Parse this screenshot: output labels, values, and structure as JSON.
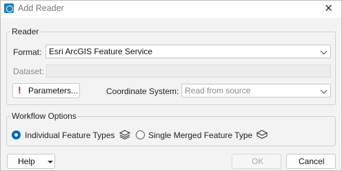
{
  "window": {
    "title": "Add Reader",
    "close_glyph": "✕"
  },
  "reader_group": {
    "label": "Reader",
    "format_label": "Format:",
    "format_value": "Esri ArcGIS Feature Service",
    "dataset_label": "Dataset:",
    "dataset_value": "",
    "parameters_icon": "!",
    "parameters_label": "Parameters...",
    "coord_label": "Coordinate System:",
    "coord_value": "Read from source"
  },
  "workflow_group": {
    "label": "Workflow Options",
    "options": [
      {
        "label": "Individual Feature Types",
        "selected": true,
        "icon": "layers-icon"
      },
      {
        "label": "Single Merged Feature Type",
        "selected": false,
        "icon": "merged-layers-icon"
      }
    ]
  },
  "footer": {
    "help_label": "Help",
    "ok_label": "OK",
    "cancel_label": "Cancel"
  },
  "colors": {
    "accent": "#0067c0",
    "warning": "#d21b1b"
  }
}
